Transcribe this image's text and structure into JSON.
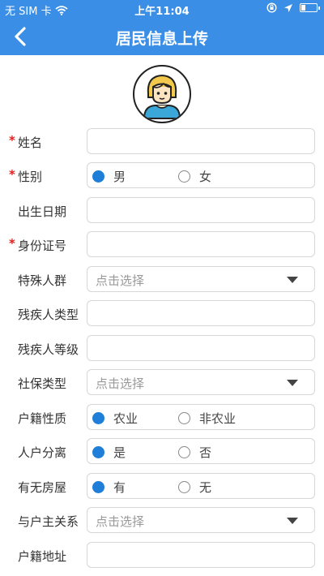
{
  "status_bar": {
    "carrier": "无 SIM 卡",
    "time": "上午11:04",
    "battery_level": 0.3
  },
  "header": {
    "title": "居民信息上传",
    "back_icon": "chevron-left-icon"
  },
  "avatar": {
    "icon": "avatar-girl-icon"
  },
  "colors": {
    "primary": "#3a8ee6",
    "radio_selected": "#1f7fd8",
    "required": "#e02020"
  },
  "form": {
    "name": {
      "label": "姓名",
      "required": "*",
      "value": ""
    },
    "gender": {
      "label": "性别",
      "required": "*",
      "options": [
        "男",
        "女"
      ],
      "selected": "男"
    },
    "birth_date": {
      "label": "出生日期",
      "value": ""
    },
    "id_number": {
      "label": "身份证号",
      "required": "*",
      "value": ""
    },
    "special_group": {
      "label": "特殊人群",
      "placeholder": "点击选择"
    },
    "disability_type": {
      "label": "残疾人类型",
      "value": ""
    },
    "disability_level": {
      "label": "残疾人等级",
      "value": ""
    },
    "social_security_type": {
      "label": "社保类型",
      "placeholder": "点击选择"
    },
    "household_nature": {
      "label": "户籍性质",
      "options": [
        "农业",
        "非农业"
      ],
      "selected": "农业"
    },
    "household_separation": {
      "label": "人户分离",
      "options": [
        "是",
        "否"
      ],
      "selected": "是"
    },
    "has_house": {
      "label": "有无房屋",
      "options": [
        "有",
        "无"
      ],
      "selected": "有"
    },
    "householder_relation": {
      "label": "与户主关系",
      "placeholder": "点击选择"
    },
    "household_address": {
      "label": "户籍地址",
      "value": ""
    }
  }
}
